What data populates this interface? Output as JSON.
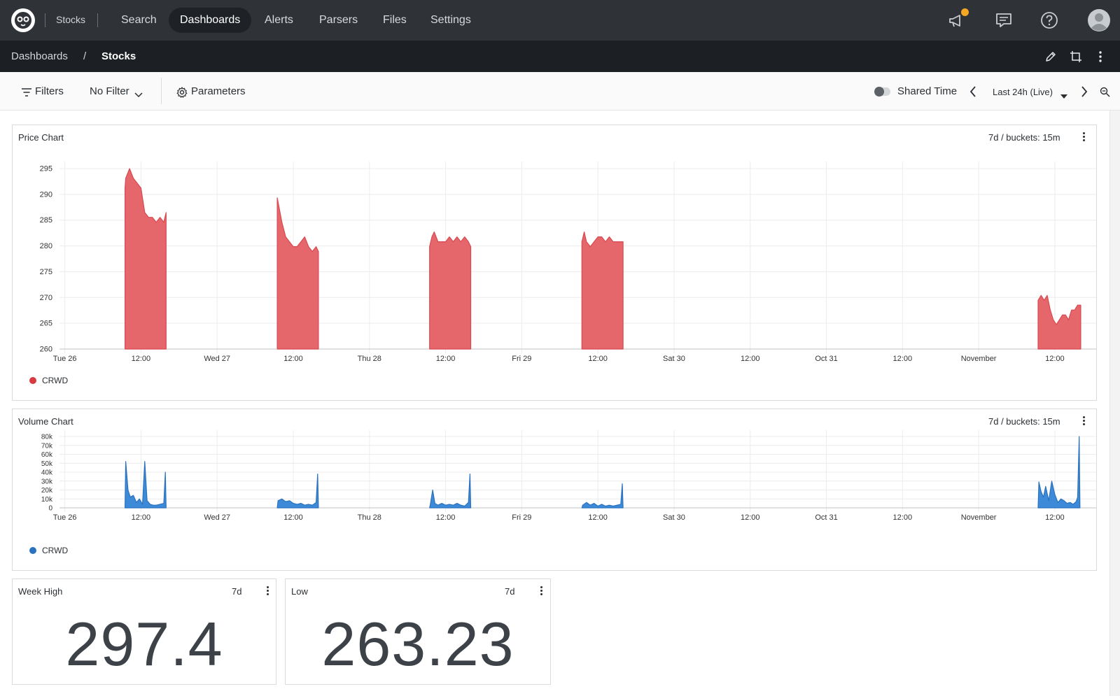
{
  "nav": {
    "repo": "Stocks",
    "items": [
      "Search",
      "Dashboards",
      "Alerts",
      "Parsers",
      "Files",
      "Settings"
    ],
    "active": "Dashboards"
  },
  "breadcrumb": {
    "parent": "Dashboards",
    "separator": "/",
    "current": "Stocks"
  },
  "toolbar": {
    "filters_label": "Filters",
    "filter_value": "No Filter",
    "parameters_label": "Parameters",
    "shared_time_label": "Shared Time",
    "time_range": "Last 24h (Live)"
  },
  "panels": {
    "price": {
      "title": "Price Chart",
      "meta": "7d / buckets: 15m",
      "legend": "CRWD",
      "color": "#e5666b",
      "stroke": "#d84a50"
    },
    "volume": {
      "title": "Volume Chart",
      "meta": "7d / buckets: 15m",
      "legend": "CRWD",
      "color": "#3d8bd8",
      "stroke": "#2a72bf"
    },
    "high": {
      "title": "Week High",
      "meta": "7d",
      "value": "297.4"
    },
    "low": {
      "title": "Low",
      "meta": "7d",
      "value": "263.23"
    }
  },
  "chart_data": [
    {
      "type": "area",
      "name": "price-chart",
      "series_name": "CRWD",
      "x_ticks": [
        "Tue 26",
        "12:00",
        "Wed 27",
        "12:00",
        "Thu 28",
        "12:00",
        "Fri 29",
        "12:00",
        "Sat 30",
        "12:00",
        "Oct 31",
        "12:00",
        "November",
        "12:00"
      ],
      "y_ticks": [
        260,
        265,
        270,
        275,
        280,
        285,
        290,
        295
      ],
      "ylim": [
        260,
        297
      ],
      "xlim": [
        -0.07,
        13.58
      ],
      "segments": [
        {
          "x": [
            0.79,
            0.8,
            0.85,
            0.9,
            0.95,
            1.0,
            1.05,
            1.1,
            1.15,
            1.2,
            1.25,
            1.3,
            1.33
          ],
          "y": [
            293,
            295,
            297,
            295,
            294,
            293,
            288,
            287,
            287,
            286,
            287,
            286,
            288
          ]
        },
        {
          "x": [
            2.79,
            2.85,
            2.9,
            2.95,
            3.0,
            3.05,
            3.1,
            3.15,
            3.2,
            3.25,
            3.3,
            3.33
          ],
          "y": [
            291,
            286,
            283,
            282,
            281,
            281,
            282,
            283,
            281,
            280,
            281,
            280
          ]
        },
        {
          "x": [
            4.79,
            4.82,
            4.85,
            4.9,
            4.95,
            5.0,
            5.05,
            5.1,
            5.15,
            5.2,
            5.25,
            5.3,
            5.33
          ],
          "y": [
            281,
            283,
            284,
            282,
            282,
            282,
            283,
            282,
            283,
            282,
            283,
            282,
            281
          ]
        },
        {
          "x": [
            6.79,
            6.82,
            6.85,
            6.9,
            6.95,
            7.0,
            7.05,
            7.1,
            7.15,
            7.2,
            7.25,
            7.3,
            7.33
          ],
          "y": [
            282,
            284,
            282,
            281,
            282,
            283,
            283,
            282,
            283,
            282,
            282,
            282,
            282
          ]
        },
        {
          "x": [
            12.78,
            12.82,
            12.86,
            12.9,
            12.94,
            12.98,
            13.02,
            13.06,
            13.1,
            13.14,
            13.18,
            13.22,
            13.26,
            13.3,
            13.34
          ],
          "y": [
            270,
            271,
            270,
            271,
            268,
            266,
            265,
            266,
            267,
            267,
            266,
            268,
            268,
            269,
            269
          ]
        }
      ]
    },
    {
      "type": "area",
      "name": "volume-chart",
      "series_name": "CRWD",
      "x_ticks": [
        "Tue 26",
        "12:00",
        "Wed 27",
        "12:00",
        "Thu 28",
        "12:00",
        "Fri 29",
        "12:00",
        "Sat 30",
        "12:00",
        "Oct 31",
        "12:00",
        "November",
        "12:00"
      ],
      "y_ticks": [
        "0",
        "10k",
        "20k",
        "30k",
        "40k",
        "50k",
        "60k",
        "70k",
        "80k"
      ],
      "ylim": [
        0,
        80000
      ],
      "xlim": [
        -0.07,
        13.58
      ],
      "segments": [
        {
          "x": [
            0.79,
            0.8,
            0.83,
            0.86,
            0.9,
            0.94,
            0.98,
            1.02,
            1.05,
            1.08,
            1.12,
            1.16,
            1.2,
            1.25,
            1.3,
            1.32,
            1.33
          ],
          "y": [
            0,
            52000,
            20000,
            12000,
            14000,
            6000,
            10000,
            4000,
            52000,
            8000,
            4000,
            3000,
            3000,
            4000,
            5000,
            40000,
            0
          ]
        },
        {
          "x": [
            2.79,
            2.8,
            2.85,
            2.9,
            2.95,
            3.0,
            3.05,
            3.1,
            3.15,
            3.2,
            3.25,
            3.3,
            3.32,
            3.33
          ],
          "y": [
            0,
            8000,
            10000,
            7000,
            8000,
            5000,
            4000,
            5000,
            3000,
            4000,
            3000,
            6000,
            38000,
            0
          ]
        },
        {
          "x": [
            4.79,
            4.8,
            4.83,
            4.86,
            4.9,
            4.95,
            5.0,
            5.05,
            5.1,
            5.15,
            5.2,
            5.25,
            5.3,
            5.32,
            5.33
          ],
          "y": [
            0,
            4000,
            20000,
            5000,
            3000,
            5000,
            3000,
            4000,
            3000,
            5000,
            3000,
            2000,
            6000,
            38000,
            0
          ]
        },
        {
          "x": [
            6.79,
            6.8,
            6.85,
            6.9,
            6.95,
            7.0,
            7.05,
            7.1,
            7.15,
            7.2,
            7.25,
            7.3,
            7.32,
            7.33
          ],
          "y": [
            0,
            3000,
            6000,
            3000,
            5000,
            2000,
            4000,
            2000,
            3000,
            2000,
            3000,
            4000,
            27000,
            0
          ]
        },
        {
          "x": [
            12.78,
            12.79,
            12.82,
            12.85,
            12.88,
            12.92,
            12.96,
            13.0,
            13.04,
            13.08,
            13.12,
            13.16,
            13.2,
            13.24,
            13.28,
            13.3,
            13.32,
            13.33
          ],
          "y": [
            0,
            29000,
            18000,
            12000,
            24000,
            8000,
            30000,
            15000,
            6000,
            10000,
            8000,
            5000,
            6000,
            4000,
            7000,
            12000,
            80000,
            0
          ]
        }
      ]
    }
  ]
}
